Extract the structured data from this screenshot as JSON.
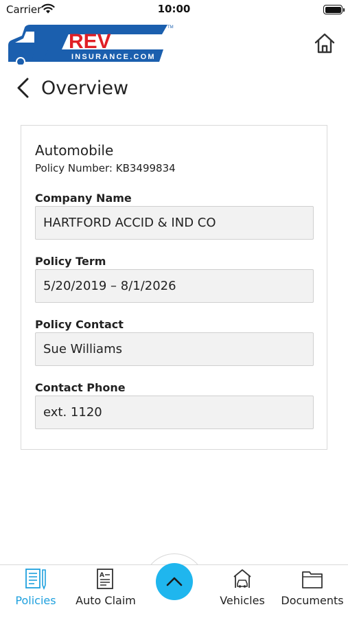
{
  "status_bar": {
    "carrier": "Carrier",
    "time": "10:00"
  },
  "header": {
    "logo_text": "REV",
    "logo_subtext": "INSURANCE.COM",
    "logo_tm": "TM"
  },
  "nav": {
    "title": "Overview"
  },
  "policy": {
    "type": "Automobile",
    "number_label": "Policy Number: KB3499834",
    "fields": [
      {
        "label": "Company Name",
        "value": "HARTFORD ACCID & IND CO"
      },
      {
        "label": "Policy Term",
        "value": "5/20/2019 – 8/1/2026"
      },
      {
        "label": "Policy Contact",
        "value": "Sue Williams"
      },
      {
        "label": "Contact Phone",
        "value": "ext. 1120"
      }
    ]
  },
  "tab_bar": {
    "tabs": [
      {
        "label": "Policies",
        "icon": "policies-icon",
        "active": true
      },
      {
        "label": "Auto Claim",
        "icon": "auto-claim-icon",
        "active": false
      },
      {
        "label": "Vehicles",
        "icon": "vehicles-icon",
        "active": false
      },
      {
        "label": "Documents",
        "icon": "documents-icon",
        "active": false
      }
    ],
    "center_icon": "chevron-up-icon"
  },
  "colors": {
    "brand_blue": "#1b5fae",
    "brand_red": "#e01f26",
    "accent": "#1fb6ee",
    "active_tab": "#1ea0de"
  }
}
